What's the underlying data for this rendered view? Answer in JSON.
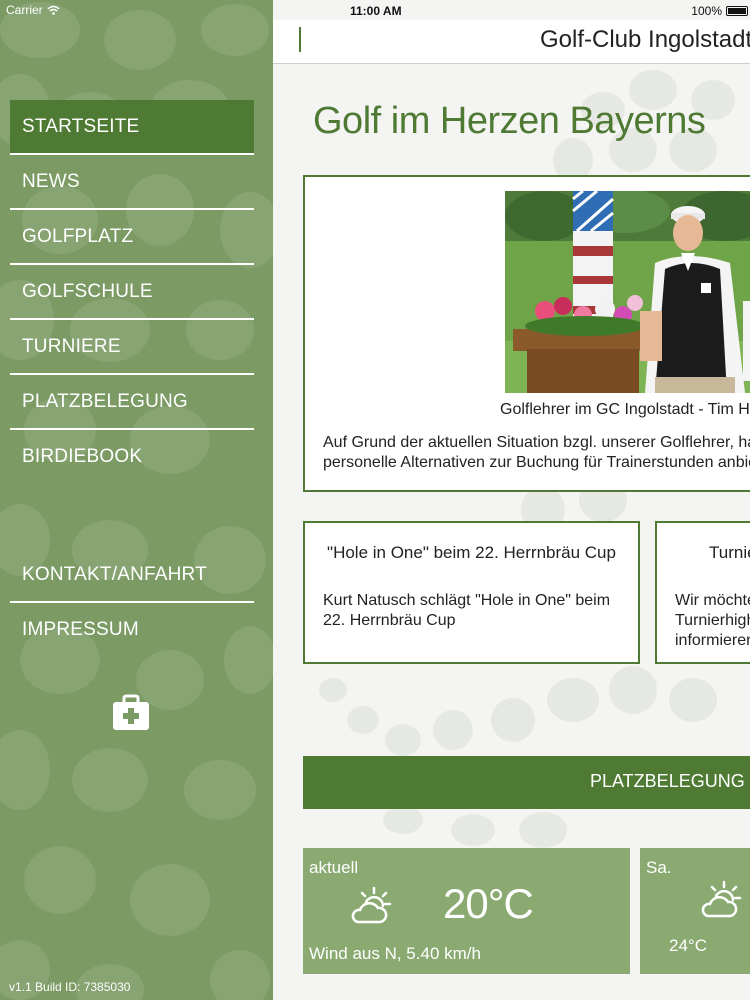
{
  "status_bar": {
    "carrier": "Carrier",
    "time": "11:00 AM",
    "battery": "100%"
  },
  "sidebar": {
    "items": [
      {
        "label": "STARTSEITE",
        "active": true
      },
      {
        "label": "NEWS"
      },
      {
        "label": "GOLFPLATZ"
      },
      {
        "label": "GOLFSCHULE"
      },
      {
        "label": "TURNIERE"
      },
      {
        "label": "PLATZBELEGUNG"
      },
      {
        "label": "BIRDIEBOOK"
      }
    ],
    "secondary_items": [
      {
        "label": "KONTAKT/ANFAHRT"
      },
      {
        "label": "IMPRESSUM"
      }
    ],
    "build_info": "v1.1  Build ID:  7385030"
  },
  "header": {
    "title": "Golf-Club Ingolstadt e.V"
  },
  "main": {
    "headline": "Golf im Herzen Bayerns",
    "feature": {
      "caption": "Golflehrer im GC Ingolstadt - Tim Hof",
      "text_line1": "Auf Grund der aktuellen Situation bzgl. unserer Golflehrer, hat sich",
      "text_line2": "personelle Alternativen zur Buchung für Trainerstunden anbieten"
    },
    "cards": [
      {
        "title": "\"Hole in One\" beim 22. Herrnbräu Cup",
        "body": "Kurt Natusch schlägt \"Hole in One\" beim 22. Herrnbräu Cup"
      },
      {
        "title": "Turnie",
        "body_lines": [
          "Wir möchte",
          "Turnierhigh",
          "informieren"
        ]
      }
    ],
    "platz_button": "PLATZBELEGUNG",
    "weather": [
      {
        "label": "aktuell",
        "temp": "20°C",
        "wind": "Wind aus N, 5.40 km/h",
        "icon": "partly-cloudy-icon"
      },
      {
        "label": "Sa.",
        "temp": "24°C",
        "icon": "partly-cloudy-icon"
      }
    ]
  },
  "colors": {
    "sidebar_bg": "#7b9a64",
    "accent": "#4f7a33",
    "weather_bg": "#8aaa72"
  }
}
